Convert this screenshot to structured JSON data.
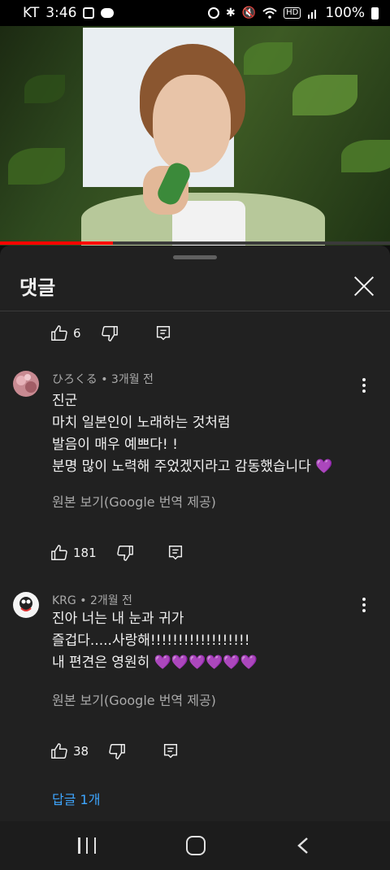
{
  "status_bar": {
    "carrier": "KT",
    "time": "3:46",
    "battery": "100%"
  },
  "video": {
    "progress_percent": 29
  },
  "panel": {
    "title": "댓글"
  },
  "top_actions": {
    "likes": "6"
  },
  "comments": [
    {
      "author": "ひろくる",
      "time": "3개월 전",
      "lines": [
        "진군",
        "마치 일본인이 노래하는 것처럼",
        "발음이 매우 예쁘다! !",
        "분명 많이 노력해 주었겠지라고 감동했습니다"
      ],
      "hearts": "💜",
      "translate_label": "원본 보기(Google 번역 제공)",
      "likes": "181"
    },
    {
      "author": "KRG",
      "time": "2개월 전",
      "lines": [
        "진아 너는 내 눈과 귀가",
        "즐겁다.....사랑해!!!!!!!!!!!!!!!!!!",
        "내 편견은 영원히"
      ],
      "hearts": "💜💜💜💜💜💜",
      "translate_label": "원본 보기(Google 번역 제공)",
      "likes": "38",
      "replies_label": "답글 1개"
    }
  ],
  "colors": {
    "background": "#0f0f0f",
    "panel": "#212121",
    "link": "#3ea6ff",
    "progress": "#ff0000",
    "heart": "#a020f0"
  },
  "icons": [
    "alarm-icon",
    "bluetooth-icon",
    "mute-icon",
    "wifi-icon",
    "signal-icon",
    "battery-icon",
    "like-icon",
    "dislike-icon",
    "reply-icon",
    "more-vert-icon",
    "close-icon"
  ]
}
